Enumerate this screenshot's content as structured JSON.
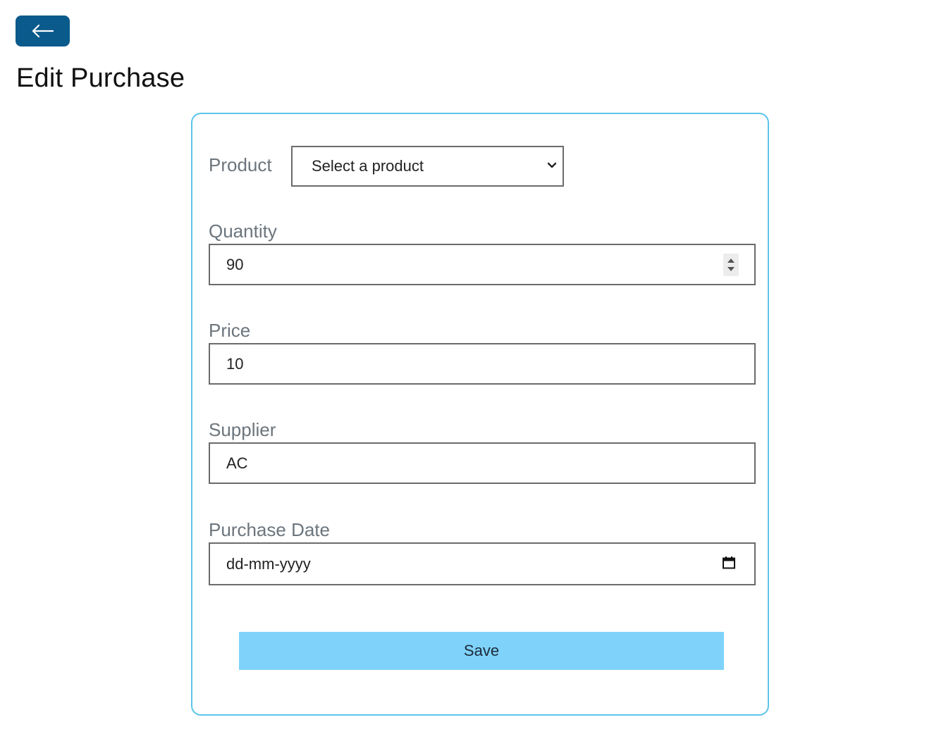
{
  "header": {
    "back_icon": "arrow-left-icon",
    "title": "Edit Purchase"
  },
  "colors": {
    "back_button_bg": "#0a5a8c",
    "card_border": "#5bc4ec",
    "save_button_bg": "#7fd3fb",
    "label_text": "#6c757d"
  },
  "form": {
    "product": {
      "label": "Product",
      "selected": "Select a product",
      "icon": "chevron-down-icon"
    },
    "quantity": {
      "label": "Quantity",
      "value": "90",
      "icon": "spinner-arrows-icon"
    },
    "price": {
      "label": "Price",
      "value": "10"
    },
    "supplier": {
      "label": "Supplier",
      "value": "AC"
    },
    "purchase_date": {
      "label": "Purchase Date",
      "value": "dd-mm-yyyy",
      "icon": "calendar-icon"
    },
    "save_label": "Save"
  }
}
